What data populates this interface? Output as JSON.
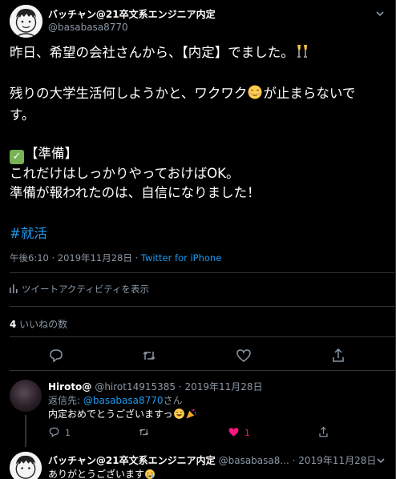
{
  "tweet": {
    "display_name": "バッチャン@21卒文系エンジニア内定",
    "handle": "@basabasa8770",
    "lines": {
      "l1": "昨日、希望の会社さんから、【内定】でました。",
      "l2a": "残りの大学生活何しようかと、ワクワク",
      "l2b": "が止まらないで",
      "l3": "す。",
      "l4": "【準備】",
      "l5": "これだけはしっかりやっておけばOK。",
      "l6": "準備が報われたのは、自信になりました！"
    },
    "hashtag": "#就活",
    "timestamp": "午後6:10 · 2019年11月28日 · ",
    "source": "Twitter for iPhone",
    "activity_label": "ツイートアクティビティを表示",
    "likes_count": "4",
    "likes_label": " いいねの数"
  },
  "icons": {
    "more": "chevron-down-icon",
    "reply": "comment-icon",
    "retweet": "retweet-icon",
    "like": "heart-icon",
    "share": "share-icon",
    "activity": "bar-chart-icon"
  },
  "replies": [
    {
      "display_name": "Hiroto@",
      "handle": "@hirot14915385",
      "date": " · 2019年11月28日",
      "reply_to_prefix": "返信先: ",
      "reply_to_handle": "@basabasa8770",
      "reply_to_suffix": "さん",
      "text": "内定おめでとうございますっ",
      "reply_count": "1",
      "like_count": "1"
    },
    {
      "display_name": "バッチャン@21卒文系エンジニア内定",
      "handle": "@basabasa8...",
      "date": " · 2019年11月28日",
      "text": "ありがとうございます"
    }
  ],
  "colors": {
    "background": "#000000",
    "accent": "#1d9bf0",
    "secondary_text": "#8b98a5",
    "liked": "#f91880"
  }
}
